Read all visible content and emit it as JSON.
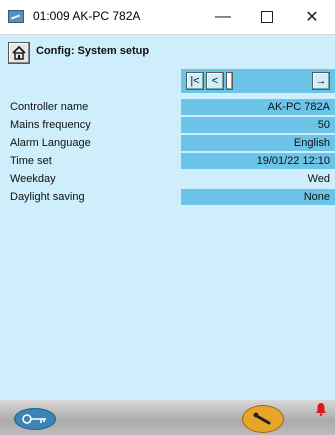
{
  "window": {
    "title": "01:009 AK-PC 782A",
    "minimize_glyph": "—",
    "close_glyph": "✕"
  },
  "page": {
    "title": "Config: System setup"
  },
  "nav": {
    "first_glyph": "|<",
    "prev_glyph": "<",
    "next_glyph": "→"
  },
  "settings": [
    {
      "label": "Controller name",
      "value": "AK-PC 782A"
    },
    {
      "label": "Mains frequency",
      "value": "50"
    },
    {
      "label": "Alarm Language",
      "value": "English"
    },
    {
      "label": "Time set",
      "value": "19/01/22 12:10"
    },
    {
      "label": "Weekday",
      "value": "Wed"
    },
    {
      "label": "Daylight saving",
      "value": "None"
    }
  ],
  "colors": {
    "background": "#cdeefa",
    "value_field": "#6cc4e8",
    "alarm_bell": "#e01818",
    "tool_button": "#e7a52a",
    "key_button": "#3b84b5"
  },
  "icons": [
    "app-icon",
    "home-icon",
    "key-icon",
    "wrench-icon",
    "alarm-bell-icon"
  ]
}
